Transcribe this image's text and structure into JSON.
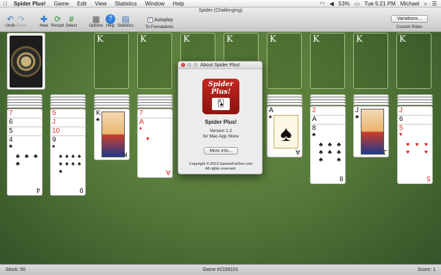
{
  "menubar": {
    "app": "Spider Plus!",
    "items": [
      "Game",
      "Edit",
      "View",
      "Statistics",
      "Window",
      "Help"
    ],
    "battery": "53%",
    "clock": "Tue 5:21 PM",
    "user": "Michael"
  },
  "window": {
    "title": "Spider (Challenging)"
  },
  "toolbar": {
    "undo": "Undo",
    "redo": "Redo",
    "new": "New",
    "restart": "Restart",
    "select": "Select",
    "options": "Options",
    "help": "Help",
    "statistics": "Statistics",
    "autoplay": "Autoplay",
    "to_foundations": "To Foundations",
    "variations": "Variations...",
    "custom_rules": "Custom Rules"
  },
  "foundation_label": "K",
  "columns": [
    {
      "cards": [
        {
          "rank": "7",
          "suit": "♦",
          "color": "red"
        },
        {
          "rank": "6",
          "suit": "♣",
          "color": "blk"
        },
        {
          "rank": "5",
          "suit": "♣",
          "color": "blk"
        },
        {
          "rank": "4",
          "suit": "♣",
          "color": "blk"
        }
      ]
    },
    {
      "cards": [
        {
          "rank": "5",
          "suit": "♥",
          "color": "red"
        },
        {
          "rank": "J",
          "suit": "♥",
          "color": "red"
        },
        {
          "rank": "10",
          "suit": "♦",
          "color": "red"
        },
        {
          "rank": "9",
          "suit": "♠",
          "color": "blk"
        }
      ]
    },
    {
      "cards": [
        {
          "rank": "K",
          "suit": "♣",
          "color": "blk"
        }
      ]
    },
    {
      "cards": [
        {
          "rank": "7",
          "suit": "♥",
          "color": "red"
        },
        {
          "rank": "A",
          "suit": "♦",
          "color": "red"
        }
      ]
    },
    {
      "cards": [
        {
          "rank": "5",
          "suit": "♦",
          "color": "red"
        }
      ]
    },
    {
      "cards": [
        {
          "rank": "A",
          "suit": "♠",
          "color": "blk"
        }
      ]
    },
    {
      "cards": [
        {
          "rank": "2",
          "suit": "♥",
          "color": "red"
        },
        {
          "rank": "A",
          "suit": "♣",
          "color": "blk"
        },
        {
          "rank": "8",
          "suit": "♣",
          "color": "blk"
        }
      ]
    },
    {
      "cards": [
        {
          "rank": "J",
          "suit": "♣",
          "color": "blk"
        }
      ]
    },
    {
      "cards": [
        {
          "rank": "J",
          "suit": "♥",
          "color": "red"
        },
        {
          "rank": "6",
          "suit": "♣",
          "color": "blk"
        },
        {
          "rank": "5",
          "suit": "♥",
          "color": "red"
        }
      ]
    }
  ],
  "dialog": {
    "title": "About Spider Plus!",
    "logo_text": "Spider Plus!",
    "name": "Spider Plus!",
    "version": "Version 1.2",
    "store": "for Mac App Store",
    "more_info": "More Info...",
    "copyright": "Copyright © 2013 GamesForOne.com",
    "rights": "All rights reserved."
  },
  "status": {
    "stock": "Stock: 50",
    "game": "Game #2159101",
    "score": "Score: 1"
  }
}
